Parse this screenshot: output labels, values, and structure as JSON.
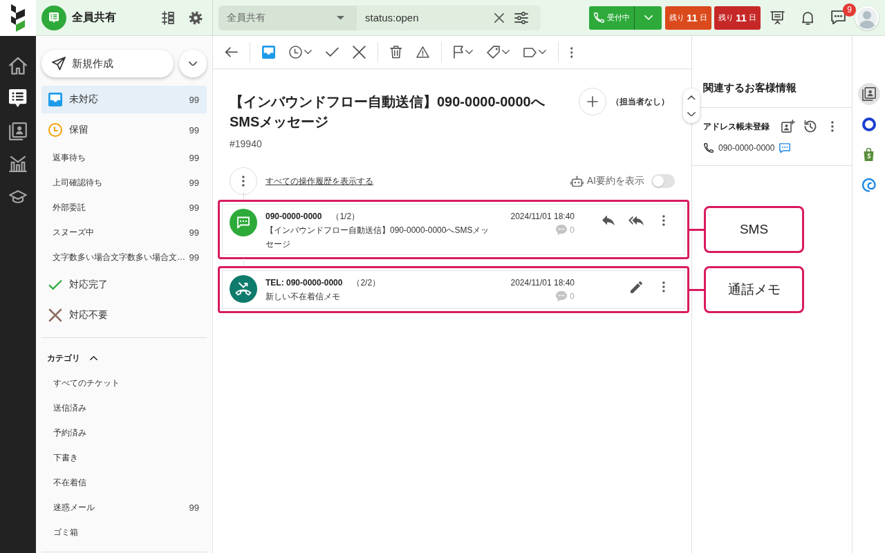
{
  "app_rail": {
    "items": [
      {
        "selected": false
      },
      {
        "selected": true
      },
      {
        "selected": false
      },
      {
        "selected": false
      },
      {
        "selected": false
      }
    ]
  },
  "header": {
    "workspace": "全員共有",
    "search": {
      "scope": "全員共有",
      "query": "status:open"
    },
    "status_button": "受付中",
    "trial_badges": [
      {
        "label": "残り **11** 日",
        "color": "#db4a1c"
      },
      {
        "label": "残り **11** 日",
        "color": "#c62828"
      }
    ],
    "chat_badge": "9"
  },
  "sidebar": {
    "new_button": "新規作成",
    "folders": [
      {
        "kind": "open",
        "label": "未対応",
        "count": "99",
        "selected": true
      },
      {
        "kind": "pending",
        "label": "保留",
        "count": "99",
        "selected": false,
        "children": [
          {
            "label": "返事待ち",
            "count": "99",
            "selected": false
          },
          {
            "label": "上司確認待ち",
            "count": "99",
            "selected": false
          },
          {
            "label": "外部委託",
            "count": "99",
            "selected": false
          },
          {
            "label": "スヌーズ中",
            "count": "99",
            "selected": false
          },
          {
            "label": "文字数多い場合文字数多い場合文…",
            "count": "99",
            "selected": false
          }
        ]
      },
      {
        "kind": "closed",
        "label": "対応完了",
        "selected": false
      },
      {
        "kind": "ignored",
        "label": "対応不要",
        "selected": false
      }
    ],
    "categories": {
      "title": "カテゴリ",
      "expanded": true,
      "items": [
        {
          "label": "すべてのチケット",
          "selected": false
        },
        {
          "label": "送信済み",
          "selected": false
        },
        {
          "label": "予約済み",
          "selected": false
        },
        {
          "label": "下書き",
          "selected": false
        },
        {
          "label": "不在着信",
          "selected": false
        },
        {
          "label": "迷惑メール",
          "count": "99",
          "selected": false
        },
        {
          "label": "ゴミ箱",
          "selected": false
        }
      ]
    }
  },
  "ticket": {
    "title": "【インバウンドフロー自動送信】090-0000-0000へSMSメッセージ",
    "number": "#19940",
    "assignee": "（担当者なし）",
    "history_link": "すべての操作履歴を表示する",
    "ai_summary": {
      "label": "AI要約を表示",
      "on": false
    },
    "messages": [
      {
        "kind": "sms",
        "sender": "090-0000-0000",
        "position": "（1/2）",
        "datetime": "2024/11/01 18:40",
        "comments": "0",
        "body": "【インバウンドフロー自動送信】090-0000-0000へSMSメッセージ",
        "annotation": "SMS"
      },
      {
        "kind": "call",
        "sender": "TEL: 090-0000-0000",
        "position": "（2/2）",
        "datetime": "2024/11/01 18:40",
        "comments": "0",
        "body": "新しい不在着信メモ",
        "annotation": "通話メモ"
      }
    ]
  },
  "customer_panel": {
    "title": "関連するお客様情報",
    "contact": {
      "name": "アドレス帳未登録",
      "phone": "090-0000-0000"
    }
  },
  "side_apps": {
    "items": [
      {
        "selected": true
      },
      {
        "selected": false
      },
      {
        "selected": false
      },
      {
        "selected": false
      }
    ]
  }
}
